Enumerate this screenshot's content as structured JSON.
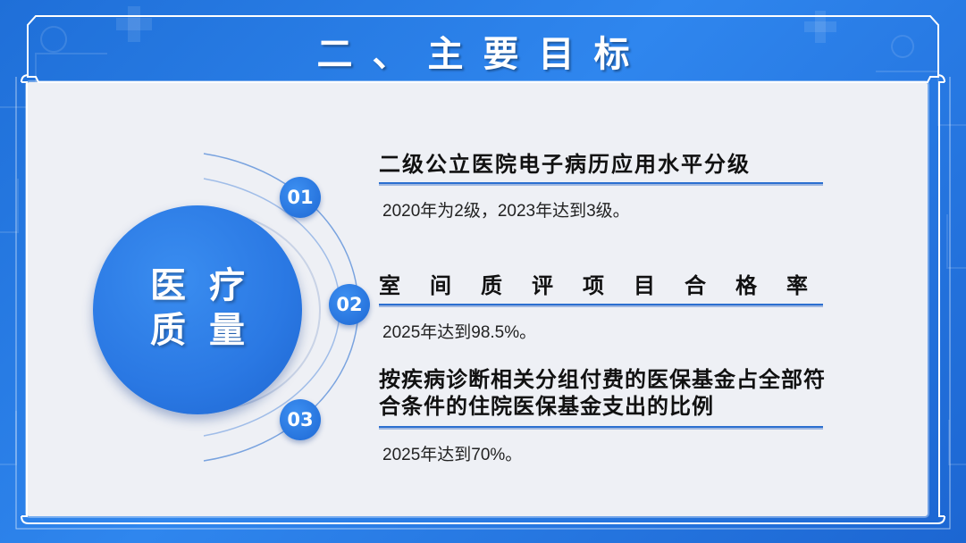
{
  "slide": {
    "title": "二、主要目标",
    "center_label_line1": "医疗",
    "center_label_line2": "质量"
  },
  "items": [
    {
      "number": "01",
      "title": "二级公立医院电子病历应用水平分级",
      "desc": "2020年为2级，2023年达到3级。"
    },
    {
      "number": "02",
      "title": "室间质评项目合格率",
      "desc": "2025年达到98.5%。"
    },
    {
      "number": "03",
      "title": "按疾病诊断相关分组付费的医保基金占全部符合条件的住院医保基金支出的比例",
      "desc": "2025年达到70%。"
    }
  ],
  "colors": {
    "accent": "#2a78e3",
    "background": "#1f6fd8",
    "panel": "#eef0f5"
  }
}
